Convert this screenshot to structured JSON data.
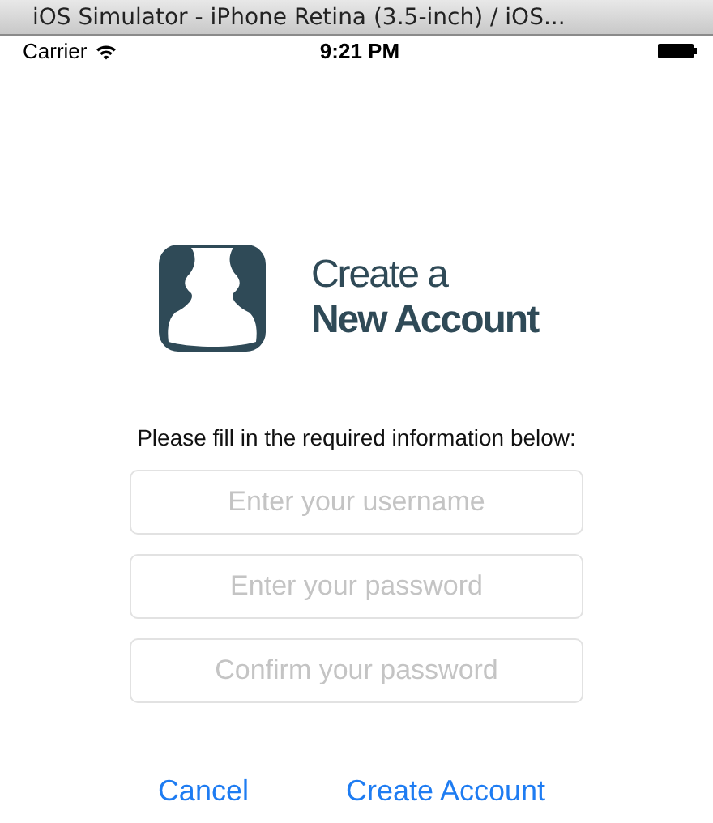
{
  "window": {
    "title": "iOS Simulator - iPhone Retina (3.5-inch) / iOS..."
  },
  "status_bar": {
    "carrier": "Carrier",
    "time": "9:21 PM"
  },
  "logo": {
    "line_1": "Create a",
    "line_2": "New Account"
  },
  "instructions": "Please fill in the required information below:",
  "fields": [
    {
      "placeholder": "Enter your username"
    },
    {
      "placeholder": "Enter your password"
    },
    {
      "placeholder": "Confirm your password"
    }
  ],
  "buttons": [
    "Cancel",
    "Create Account"
  ]
}
